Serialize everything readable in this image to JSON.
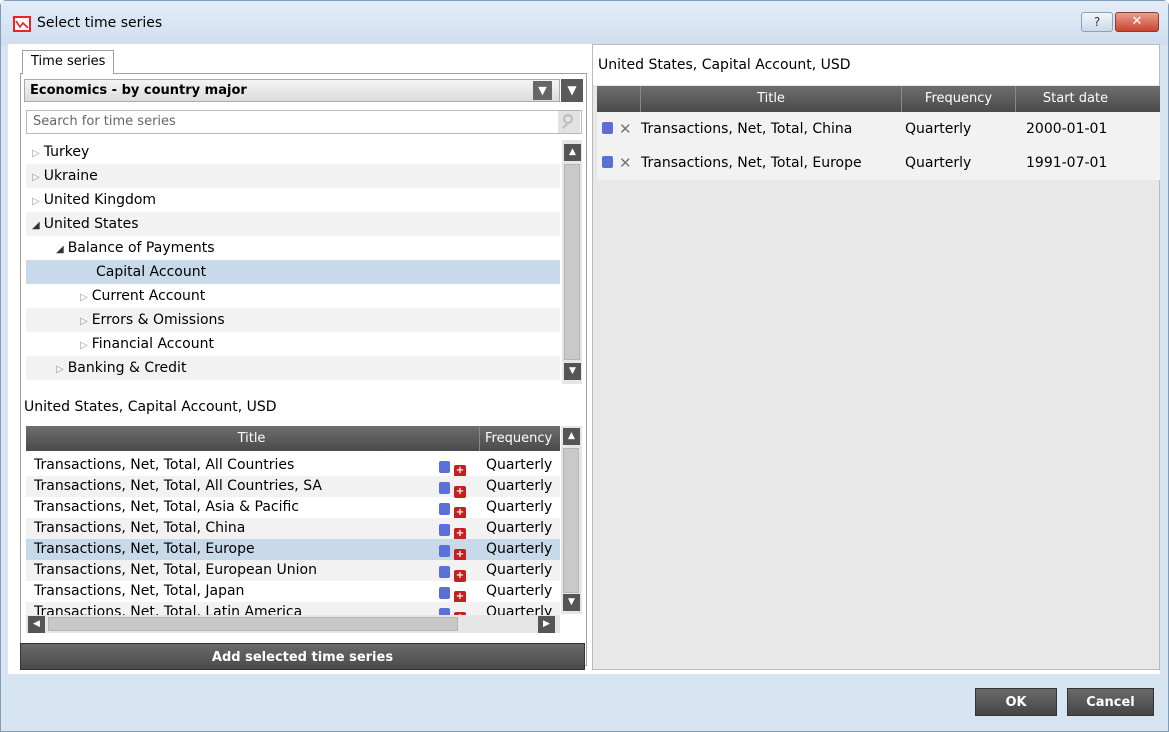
{
  "window": {
    "title": "Select time series",
    "help_label": "?",
    "close_label": "✕"
  },
  "tab": {
    "label": "Time series"
  },
  "dropdown": {
    "selected": "Economics - by country major"
  },
  "search": {
    "placeholder": "Search for time series"
  },
  "tree": {
    "items": [
      {
        "label": "Turkey",
        "level": 0,
        "expanded": false,
        "selected": false
      },
      {
        "label": "Ukraine",
        "level": 0,
        "expanded": false,
        "selected": false
      },
      {
        "label": "United Kingdom",
        "level": 0,
        "expanded": false,
        "selected": false
      },
      {
        "label": "United States",
        "level": 0,
        "expanded": true,
        "selected": false
      },
      {
        "label": "Balance of Payments",
        "level": 1,
        "expanded": true,
        "selected": false
      },
      {
        "label": "Capital Account",
        "level": 2,
        "leaf": true,
        "selected": true
      },
      {
        "label": "Current Account",
        "level": 2,
        "expanded": false,
        "selected": false
      },
      {
        "label": "Errors & Omissions",
        "level": 2,
        "expanded": false,
        "selected": false
      },
      {
        "label": "Financial Account",
        "level": 2,
        "expanded": false,
        "selected": false
      },
      {
        "label": "Banking & Credit",
        "level": 1,
        "expanded": false,
        "selected": false
      }
    ]
  },
  "series_list": {
    "label": "United States, Capital Account, USD",
    "columns": {
      "title": "Title",
      "frequency": "Frequency"
    },
    "rows": [
      {
        "title": "Transactions, Net, Total, All Countries",
        "frequency": "Quarterly",
        "selected": false
      },
      {
        "title": "Transactions, Net, Total, All Countries, SA",
        "frequency": "Quarterly",
        "selected": false
      },
      {
        "title": "Transactions, Net, Total, Asia & Pacific",
        "frequency": "Quarterly",
        "selected": false
      },
      {
        "title": "Transactions, Net, Total, China",
        "frequency": "Quarterly",
        "selected": false
      },
      {
        "title": "Transactions, Net, Total, Europe",
        "frequency": "Quarterly",
        "selected": true
      },
      {
        "title": "Transactions, Net, Total, European Union",
        "frequency": "Quarterly",
        "selected": false
      },
      {
        "title": "Transactions, Net, Total, Japan",
        "frequency": "Quarterly",
        "selected": false
      },
      {
        "title": "Transactions, Net, Total, Latin America",
        "frequency": "Quarterly",
        "selected": false
      }
    ],
    "add_button": "Add selected time series"
  },
  "selected_series": {
    "label": "United States, Capital Account, USD",
    "columns": {
      "title": "Title",
      "frequency": "Frequency",
      "start_date": "Start date"
    },
    "rows": [
      {
        "title": "Transactions, Net, Total, China",
        "frequency": "Quarterly",
        "start_date": "2000-01-01"
      },
      {
        "title": "Transactions, Net, Total, Europe",
        "frequency": "Quarterly",
        "start_date": "1991-07-01"
      }
    ]
  },
  "footer": {
    "ok": "OK",
    "cancel": "Cancel"
  }
}
